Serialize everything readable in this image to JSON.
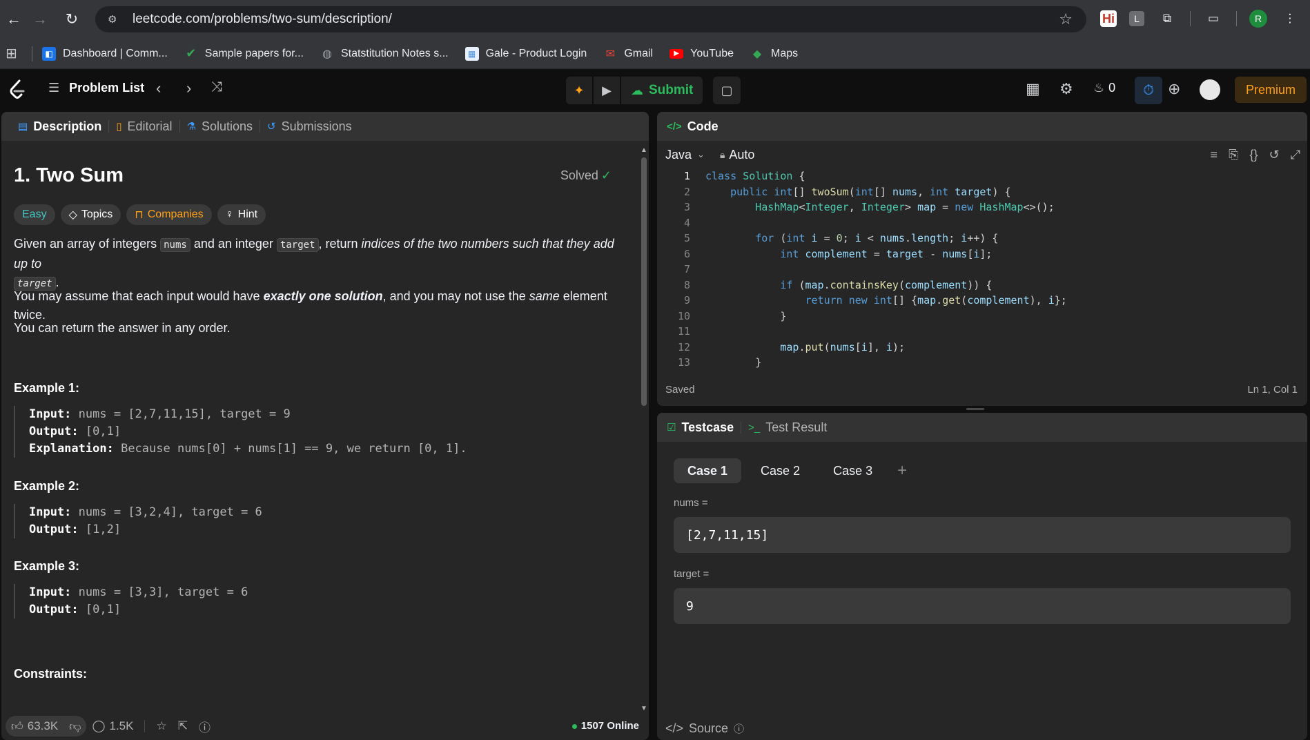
{
  "browser": {
    "url": "leetcode.com/problems/two-sum/description/",
    "extensions": [
      "Hi",
      "L"
    ],
    "profile_initial": "R",
    "bookmarks": [
      {
        "label": "Dashboard | Comm...",
        "icon": "dashboard-favicon",
        "color": "#1a73e8"
      },
      {
        "label": "Sample papers for...",
        "icon": "checkmark-favicon",
        "color": "#34a853"
      },
      {
        "label": "Statstitution Notes s...",
        "icon": "globe-favicon",
        "color": "#9aa0a6"
      },
      {
        "label": "Gale - Product Login",
        "icon": "gale-favicon",
        "color": "#4a90d9"
      },
      {
        "label": "Gmail",
        "icon": "gmail-favicon",
        "color": "#ea4335"
      },
      {
        "label": "YouTube",
        "icon": "youtube-favicon",
        "color": "#ff0000"
      },
      {
        "label": "Maps",
        "icon": "maps-favicon",
        "color": "#34a853"
      }
    ]
  },
  "lc_nav": {
    "problem_list": "Problem List",
    "submit": "Submit",
    "streak": "0",
    "premium": "Premium"
  },
  "description": {
    "tabs": [
      "Description",
      "Editorial",
      "Solutions",
      "Submissions"
    ],
    "title": "1. Two Sum",
    "status": "Solved",
    "tags": [
      "Easy",
      "Topics",
      "Companies",
      "Hint"
    ],
    "p1_a": "Given an array of integers ",
    "p1_code1": "nums",
    "p1_b": " and an integer ",
    "p1_code2": "target",
    "p1_c": ", return ",
    "p1_em": "indices of the two numbers such that they add up to",
    "p1_code3": "target",
    "p1_d": ".",
    "p2_a": "You may assume that each input would have ",
    "p2_strong": "exactly one solution",
    "p2_b": ", and you may not use the ",
    "p2_em": "same",
    "p2_c": " element twice.",
    "p3": "You can return the answer in any order.",
    "examples": [
      {
        "title": "Example 1:",
        "input": "nums = [2,7,11,15], target = 9",
        "output": "[0,1]",
        "explanation": "Because nums[0] + nums[1] == 9, we return [0, 1]."
      },
      {
        "title": "Example 2:",
        "input": "nums = [3,2,4], target = 6",
        "output": "[1,2]"
      },
      {
        "title": "Example 3:",
        "input": "nums = [3,3], target = 6",
        "output": "[0,1]"
      }
    ],
    "labels": {
      "input": "Input:",
      "output": "Output:",
      "explanation": "Explanation:"
    },
    "constraints_title": "Constraints:",
    "footer": {
      "likes": "63.3K",
      "comments": "1.5K",
      "online": "1507 Online"
    }
  },
  "code": {
    "tab": "Code",
    "language": "Java",
    "mode": "Auto",
    "status": "Saved",
    "cursor": "Ln 1, Col 1",
    "lines": [
      "class Solution {",
      "    public int[] twoSum(int[] nums, int target) {",
      "        HashMap<Integer, Integer> map = new HashMap<>();",
      "",
      "        for (int i = 0; i < nums.length; i++) {",
      "            int complement = target - nums[i];",
      "",
      "            if (map.containsKey(complement)) {",
      "                return new int[] {map.get(complement), i};",
      "            }",
      "",
      "            map.put(nums[i], i);",
      "        }"
    ]
  },
  "test": {
    "tabs": [
      "Testcase",
      "Test Result"
    ],
    "cases": [
      "Case 1",
      "Case 2",
      "Case 3"
    ],
    "vars": [
      {
        "label": "nums =",
        "value": "[2,7,11,15]"
      },
      {
        "label": "target =",
        "value": "9"
      }
    ],
    "source": "Source"
  }
}
